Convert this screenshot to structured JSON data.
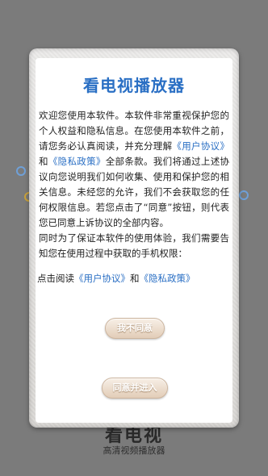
{
  "background": {
    "app_name": "看电视",
    "app_subtitle": "高清视频播放器"
  },
  "dialog": {
    "title": "看电视播放器",
    "paragraphs": [
      {
        "before": "欢迎您使用本软件。本软件非常重视保护您的个人权益和隐私信息。在您使用本软件之前，请您务必认真阅读，并充分理解",
        "link1": "《用户协议》",
        "middle": "和",
        "link2": "《隐私政策》",
        "after": "全部条款。我们将通过上述协议向您说明我们如何收集、使用和保护您的相关信息。未经您的允许，我们不会获取您的任何权限信息。若您点击了“同意”按钮，则代表您已同意上诉协议的全部内容。"
      },
      {
        "text": "同时为了保证本软件的使用体验，我们需要告知您在使用过程中获取的手机权限："
      }
    ],
    "agree_line": {
      "prefix": "点击阅读",
      "link1": "《用户协议》",
      "middle": "和",
      "link2": "《隐私政策》"
    },
    "disagree_label": "我不同意",
    "agree_label": "同意并进入"
  },
  "colors": {
    "link": "#2a6fc4",
    "title": "#2a6fc4",
    "overlay": "#7b7b7b"
  }
}
